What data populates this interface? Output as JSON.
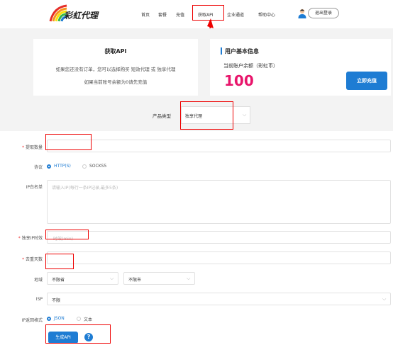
{
  "header": {
    "logo_text": "彩虹代理",
    "nav": [
      "首页",
      "套餐",
      "充值",
      "获取API",
      "企业通道",
      "帮助中心"
    ],
    "logout": "退出登录"
  },
  "card_api": {
    "title": "获取API",
    "line1": "如果您还没有订单，您可以选择购买 短效代理 或 独享代理",
    "line2": "如果当前账号余额为0请先充值"
  },
  "card_user": {
    "title": "用户基本信息",
    "balance_label": "当前账户余额（彩虹币）",
    "balance": "100",
    "recharge_button": "立即充值"
  },
  "product_type": {
    "label": "产品类型",
    "value": "独享代理"
  },
  "form": {
    "extract_count": {
      "label": "提取数量",
      "value": ""
    },
    "protocol": {
      "label": "协议",
      "options": [
        "HTTP(S)",
        "SOCKS5"
      ],
      "selected": "HTTP(S)"
    },
    "ip_whitelist": {
      "label": "IP白名单",
      "placeholder": "请输入IP(每行一条IP记录,最多5条)"
    },
    "exclusive_time": {
      "label": "独享IP时效",
      "placeholder": "时效(min)"
    },
    "dedup_days": {
      "label": "去重天数",
      "value": ""
    },
    "region": {
      "label": "地域",
      "province": "不限省",
      "city": "不限市"
    },
    "isp": {
      "label": "ISP",
      "value": "不限"
    },
    "return_format": {
      "label": "IP返回格式",
      "options": [
        "JSON",
        "文本"
      ],
      "selected": "JSON"
    },
    "generate_button": "生成API",
    "help": "?"
  },
  "colors": {
    "accent": "#1e7cd3",
    "balance": "#e8156b",
    "annotation": "#e00000"
  }
}
